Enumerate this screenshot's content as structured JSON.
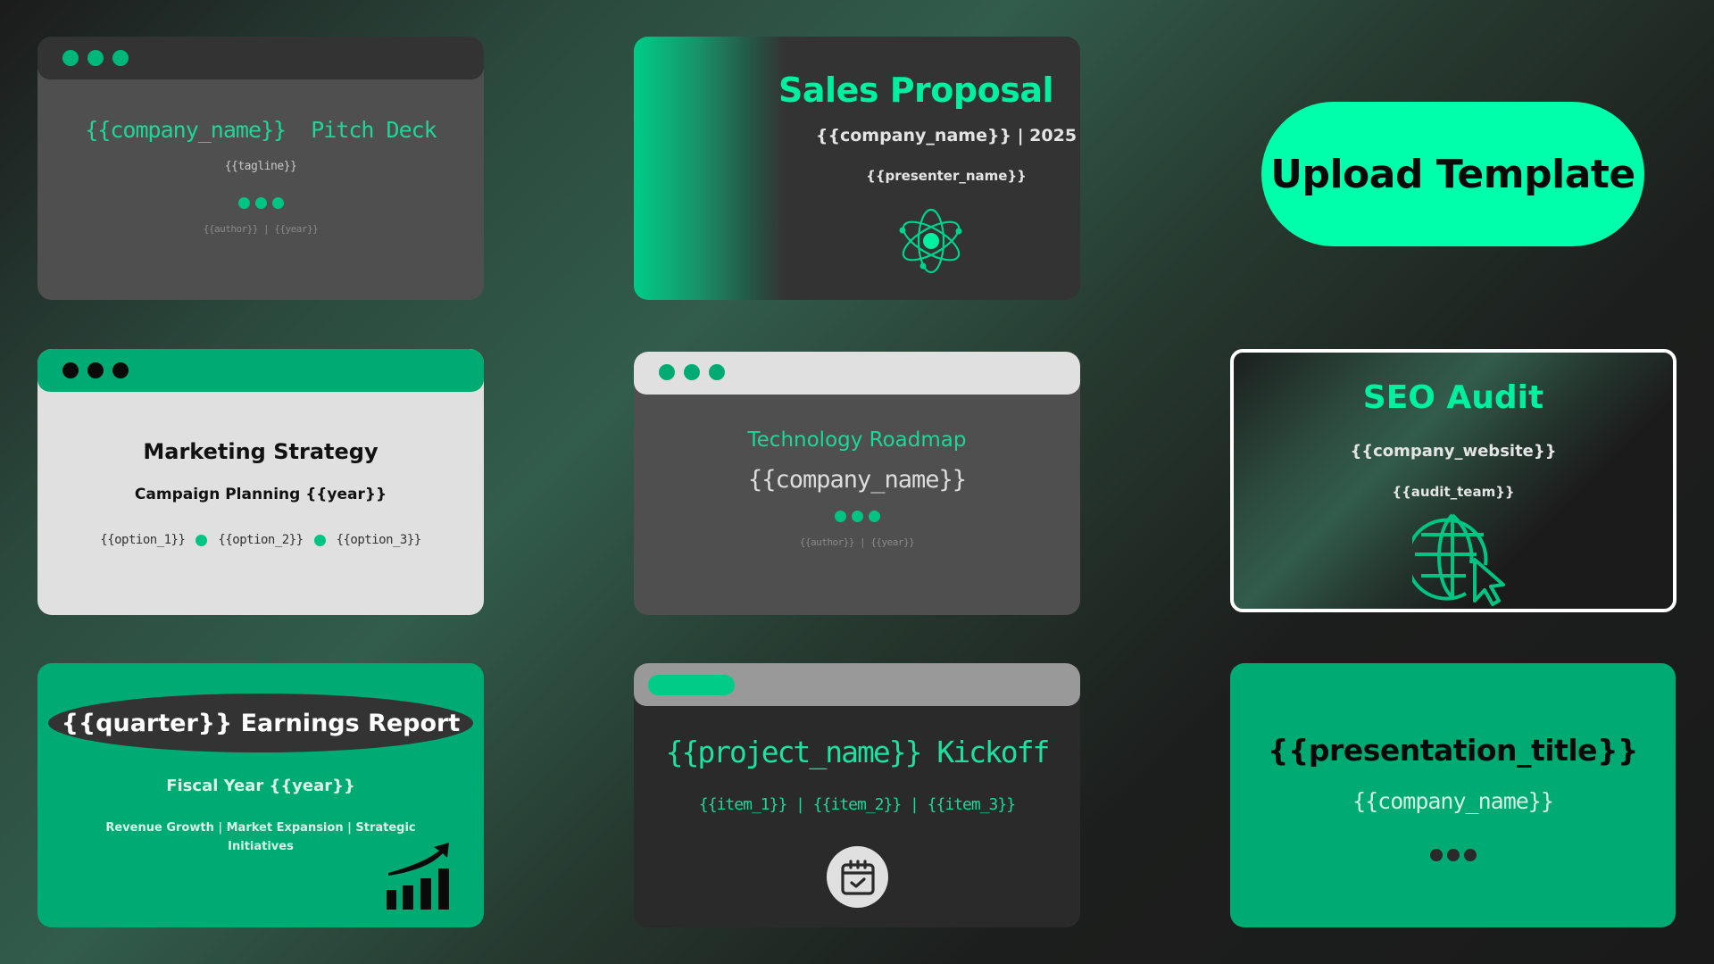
{
  "colors": {
    "accent": "#00ffaa",
    "accent_dark": "#00ab73",
    "card_dark": "#333333",
    "card_gray": "#4f4f4f",
    "card_light": "#e0e0e0"
  },
  "upload_button": {
    "label": "Upload Template",
    "icon": "none"
  },
  "templates": [
    {
      "id": "pitch-deck",
      "title_line": "{{company_name}}  Pitch Deck",
      "subtitle": "{{tagline}}",
      "footer": "{{author}} | {{year}}",
      "window_dots": 3,
      "decor_dots": 3
    },
    {
      "id": "sales-proposal",
      "title": "Sales Proposal",
      "subtitle": "{{company_name}} | 2025",
      "presenter": "{{presenter_name}}",
      "icon": "atom-icon"
    },
    {
      "id": "marketing-strategy",
      "title": "Marketing Strategy",
      "subtitle": "Campaign Planning {{year}}",
      "options": [
        "{{option_1}}",
        "{{option_2}}",
        "{{option_3}}"
      ],
      "window_dots": 3
    },
    {
      "id": "technology-roadmap",
      "title": "Technology Roadmap",
      "subtitle": "{{company_name}}",
      "footer": "{{author}} | {{year}}",
      "window_dots": 3,
      "decor_dots": 3
    },
    {
      "id": "seo-audit",
      "title": "SEO Audit",
      "subtitle": "{{company_website}}",
      "team": "{{audit_team}}",
      "icon": "globe-cursor-icon",
      "selected": true
    },
    {
      "id": "earnings-report",
      "title": "{{quarter}} Earnings Report",
      "subtitle": "Fiscal Year {{year}}",
      "topics": "Revenue Growth | Market Expansion | Strategic Initiatives",
      "icon": "growth-chart-icon"
    },
    {
      "id": "project-kickoff",
      "title": "{{project_name}} Kickoff",
      "items": "{{item_1}} | {{item_2}} | {{item_3}}",
      "icon": "calendar-check-icon"
    },
    {
      "id": "presentation",
      "title": "{{presentation_title}}",
      "subtitle": "{{company_name}}",
      "decor_dots": 3
    }
  ]
}
